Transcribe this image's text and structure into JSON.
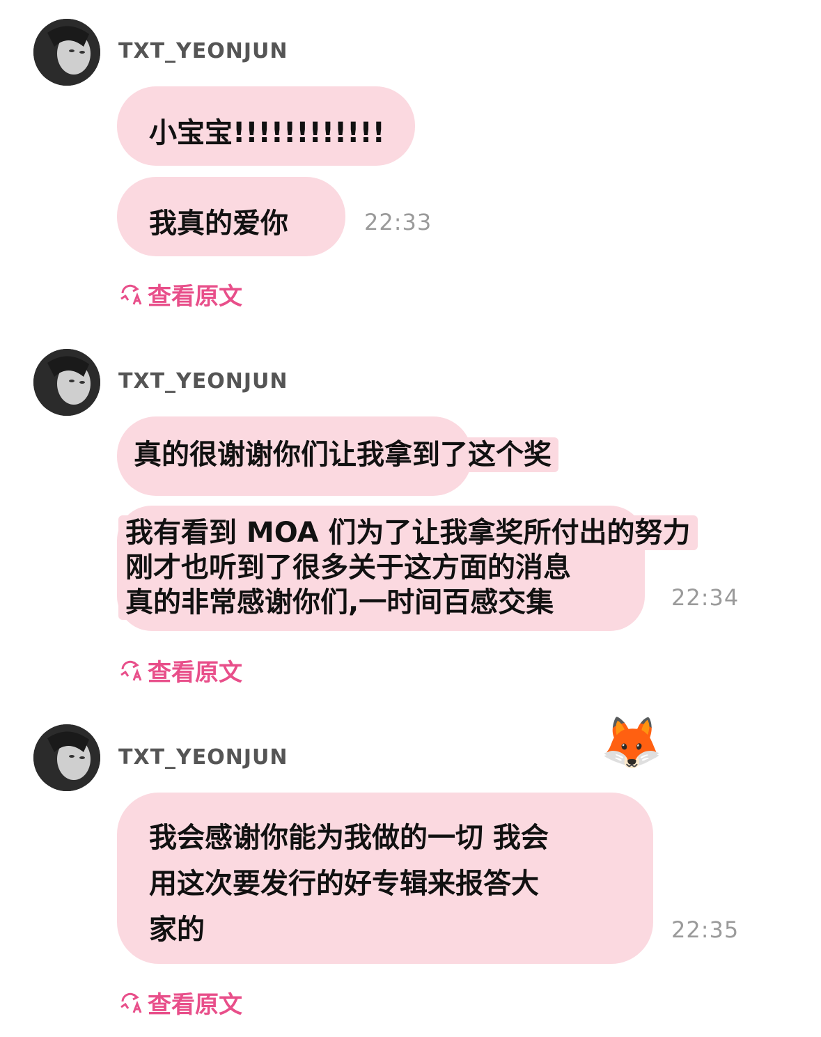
{
  "messages": [
    {
      "username": "TXT_YEONJUN",
      "bubbles": [
        "小宝宝!!!!!!!!!!!!",
        "我真的爱你"
      ],
      "time": "22:33",
      "view_original": "查看原文"
    },
    {
      "username": "TXT_YEONJUN",
      "lines": [
        "真的很谢谢你们让我拿到了这个奖",
        "我有看到 MOA 们为了让我拿奖所付出的努力",
        "刚才也听到了很多关于这方面的消息",
        "真的非常感谢你们,一时间百感交集"
      ],
      "time": "22:34",
      "view_original": "查看原文"
    },
    {
      "username": "TXT_YEONJUN",
      "emoji": "🦊",
      "lines": [
        "我会感谢你能为我做的一切 我会",
        "用这次要发行的好专辑来报答大",
        "家的"
      ],
      "time": "22:35",
      "view_original": "查看原文"
    }
  ],
  "colors": {
    "bubble": "#fbd9e0",
    "accent": "#e84f8a",
    "username": "#555555",
    "time": "#9a9a9a"
  },
  "icons": {
    "avatar": "profile-photo",
    "translate": "translate-icon"
  }
}
